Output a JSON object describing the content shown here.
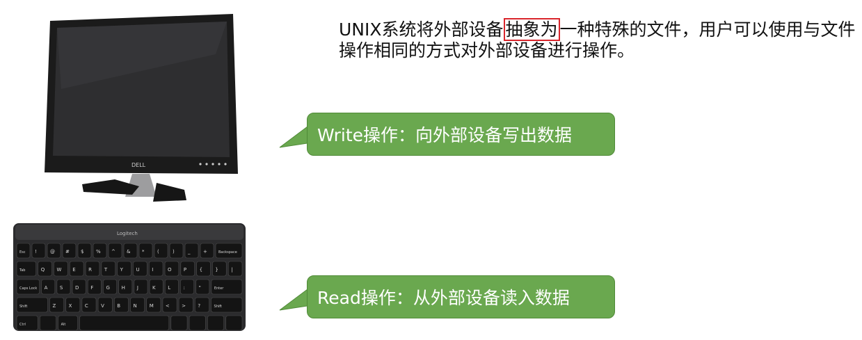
{
  "description": {
    "before": "UNIX系统将外部设备",
    "highlight": "抽象为",
    "after": "一种特殊的文件，用户可以使用与文件操作相同的方式对外部设备进行操作。"
  },
  "callouts": {
    "write": "Write操作：向外部设备写出数据",
    "read": "Read操作：从外部设备读入数据"
  },
  "monitor": {
    "brand": "DELL"
  },
  "keyboard": {
    "brand": "Logitech",
    "rows": [
      [
        "Esc",
        "!",
        "@",
        "#",
        "$",
        "%",
        "^",
        "&",
        "*",
        "(",
        ")",
        "_",
        "+",
        "Backspace"
      ],
      [
        "Tab",
        "Q",
        "W",
        "E",
        "R",
        "T",
        "Y",
        "U",
        "I",
        "O",
        "P",
        "{",
        "}",
        "|"
      ],
      [
        "Caps Lock",
        "A",
        "S",
        "D",
        "F",
        "G",
        "H",
        "J",
        "K",
        "L",
        ":",
        "\"",
        "Enter"
      ],
      [
        "Shift",
        "Z",
        "X",
        "C",
        "V",
        "B",
        "N",
        "M",
        "<",
        ">",
        "?",
        "Shift"
      ],
      [
        "Ctrl",
        "",
        "Alt",
        "",
        "",
        "",
        "",
        ""
      ]
    ]
  },
  "colors": {
    "callout": "#6aa84f",
    "highlight_border": "#d9252b"
  }
}
